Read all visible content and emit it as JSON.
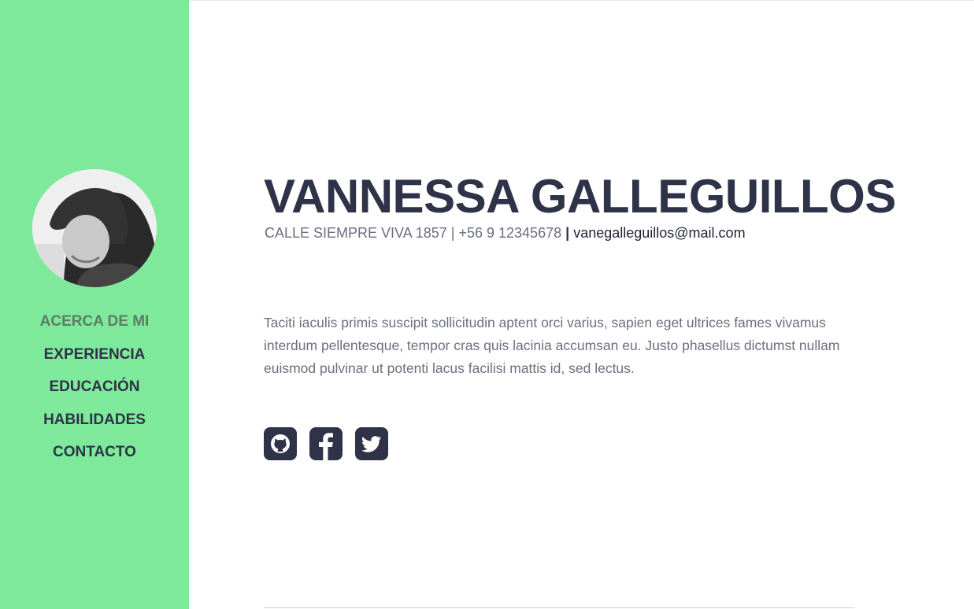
{
  "colors": {
    "sidebar_bg": "#7fe99b",
    "primary_text": "#2e3348",
    "muted_text": "#6b6f80",
    "active_nav": "#5a7d66"
  },
  "profile": {
    "avatar_alt": "avatar photo"
  },
  "nav": {
    "items": [
      {
        "label": "ACERCA DE MI",
        "active": true
      },
      {
        "label": "EXPERIENCIA"
      },
      {
        "label": "EDUCACIÓN"
      },
      {
        "label": "HABILIDADES"
      },
      {
        "label": "CONTACTO"
      }
    ]
  },
  "header": {
    "name": "VANNESSA GALLEGUILLOS",
    "address_phone": "CALLE SIEMPRE VIVA 1857 | +56 9 12345678",
    "separator": "|",
    "email": "vanegalleguillos@mail.com"
  },
  "about": {
    "text": "Taciti iaculis primis suscipit sollicitudin aptent orci varius, sapien eget ultrices fames vivamus interdum pellentesque, tempor cras quis lacinia accumsan eu. Justo phasellus dictumst nullam euismod pulvinar ut potenti lacus facilisi mattis id, sed lectus."
  },
  "social": [
    {
      "icon": "github-icon"
    },
    {
      "icon": "facebook-icon"
    },
    {
      "icon": "twitter-icon"
    }
  ]
}
